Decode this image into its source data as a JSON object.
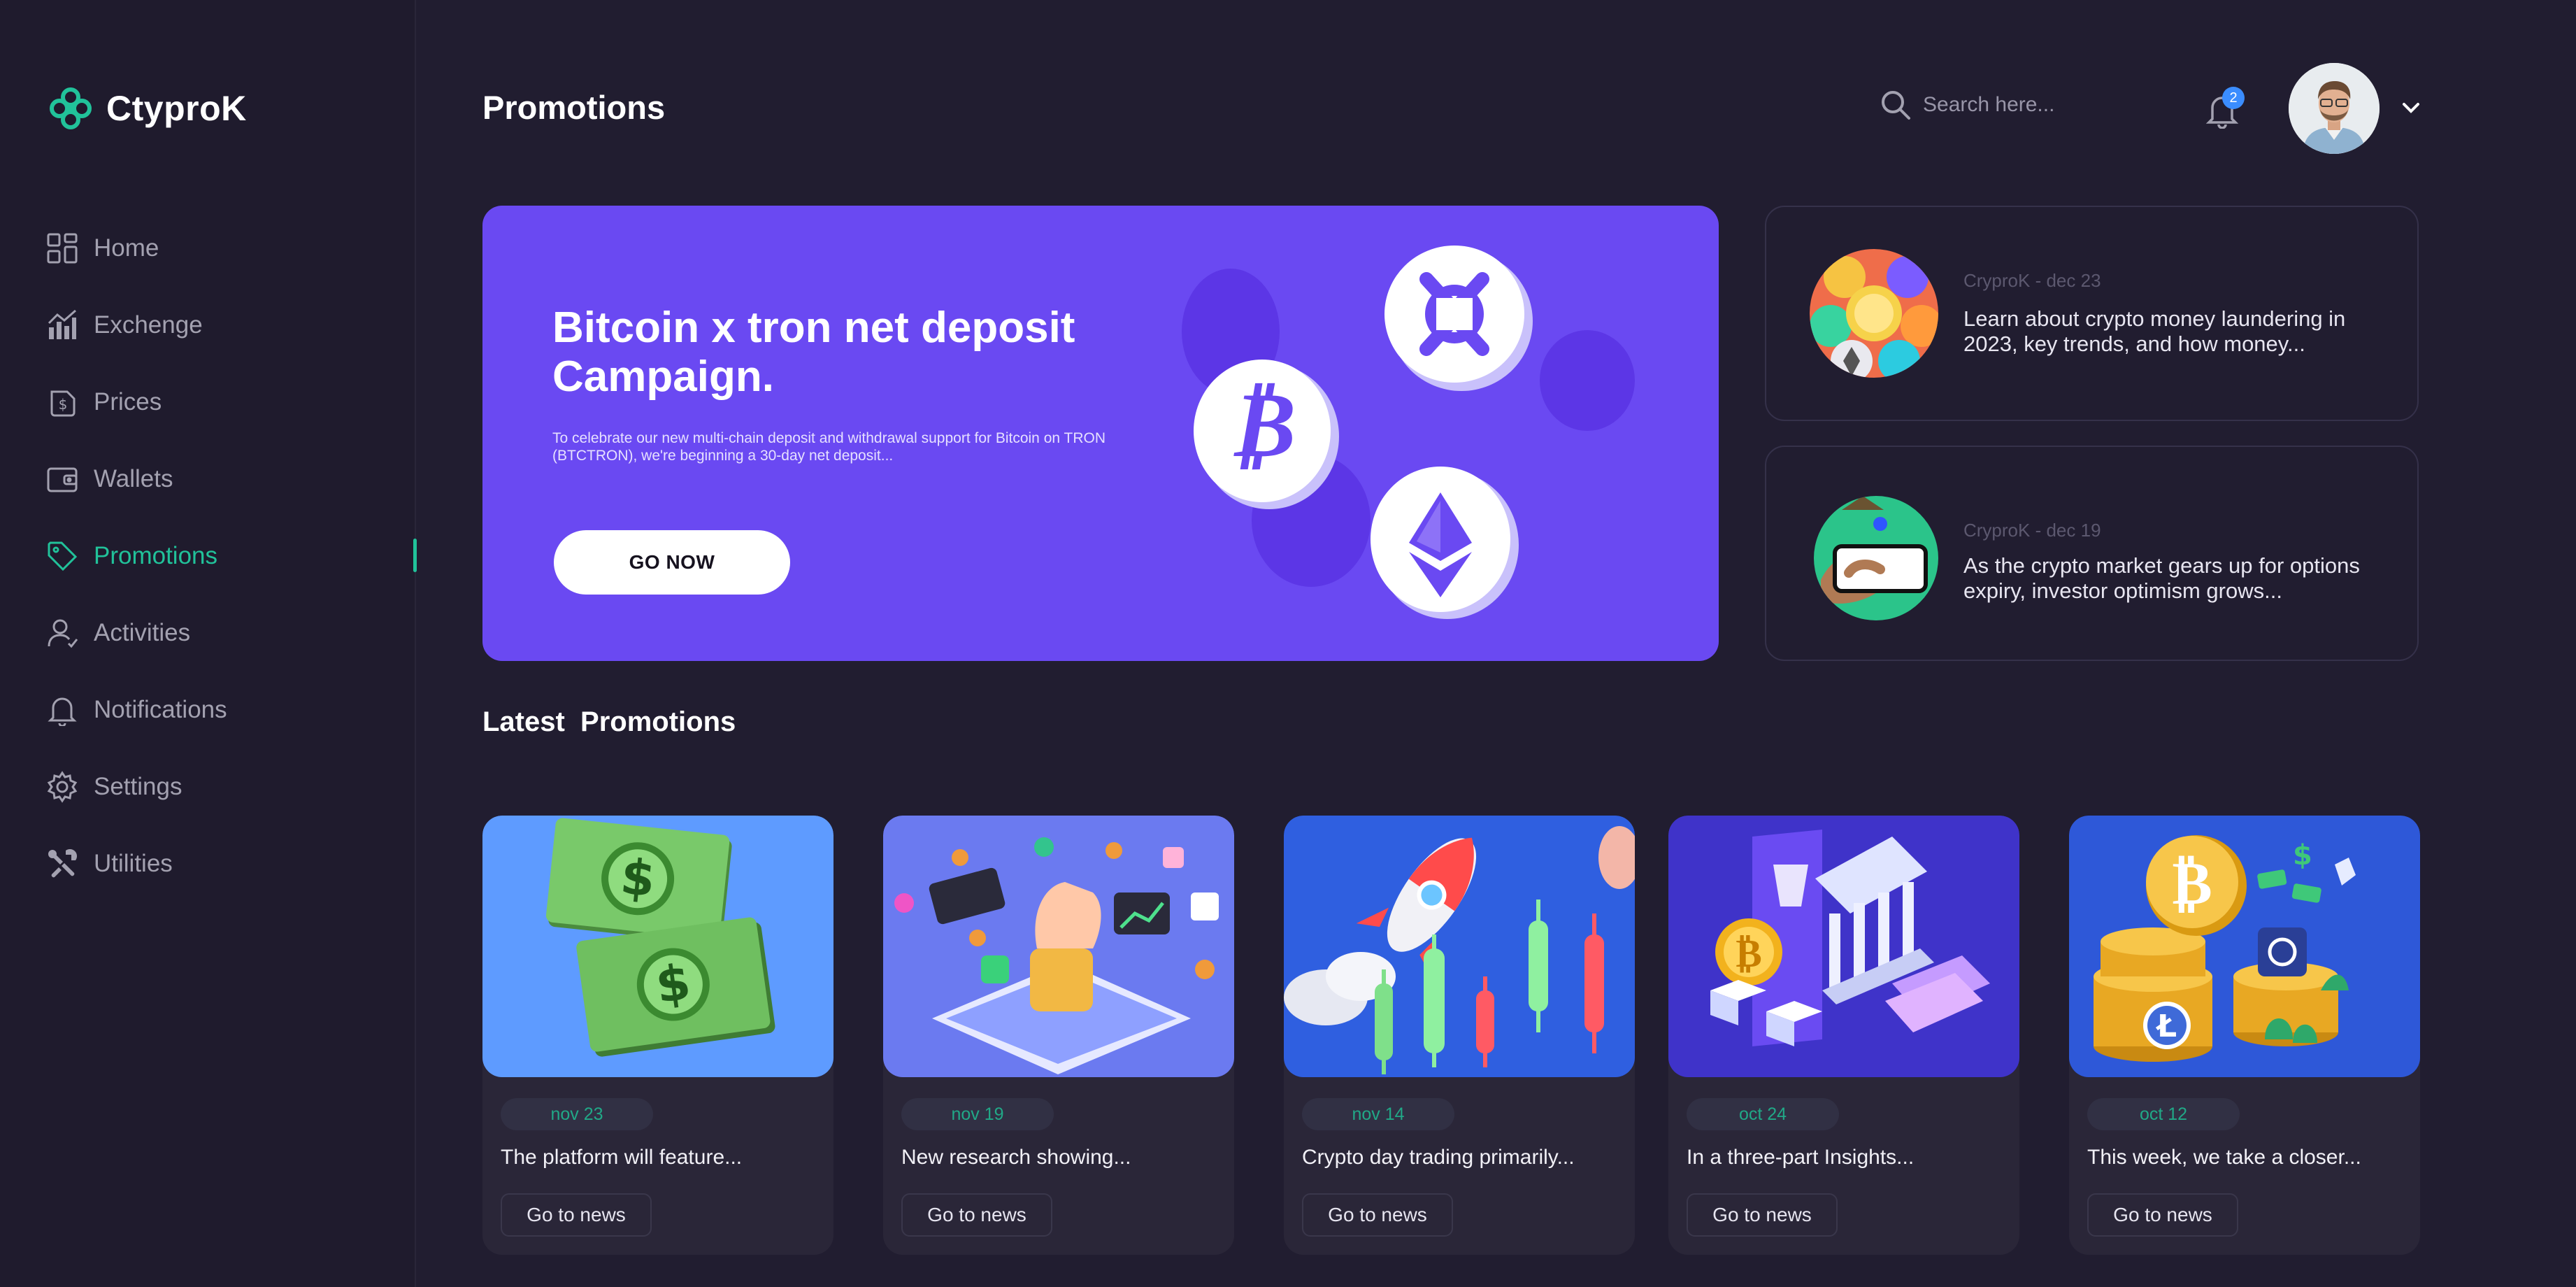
{
  "app": {
    "name": "CtyproK"
  },
  "sidebar": {
    "items": [
      {
        "label": "Home",
        "icon": "grid-icon"
      },
      {
        "label": "Exchenge",
        "icon": "chart-icon"
      },
      {
        "label": "Prices",
        "icon": "price-tag-icon"
      },
      {
        "label": "Wallets",
        "icon": "wallet-icon"
      },
      {
        "label": "Promotions",
        "icon": "tag-icon",
        "active": true
      },
      {
        "label": "Activities",
        "icon": "user-icon"
      },
      {
        "label": "Notifications",
        "icon": "bell-icon"
      },
      {
        "label": "Settings",
        "icon": "gear-icon"
      },
      {
        "label": "Utilities",
        "icon": "tools-icon"
      }
    ]
  },
  "header": {
    "title": "Promotions",
    "search_placeholder": "Search here...",
    "notification_count": "2"
  },
  "hero": {
    "title": "Bitcoin x tron net deposit Campaign.",
    "description": "To celebrate our new multi-chain deposit and withdrawal support for Bitcoin on TRON (BTCTRON), we're beginning a 30-day net deposit...",
    "button": "GO NOW"
  },
  "news": [
    {
      "meta": "CryproK - dec 23",
      "text": "Learn about crypto money laundering in 2023, key trends, and how money..."
    },
    {
      "meta": "CryproK - dec 19",
      "text": "As the crypto market gears up for options expiry, investor optimism grows..."
    }
  ],
  "latest": {
    "title": "Latest  Promotions",
    "cards": [
      {
        "date": "nov 23",
        "text": "The platform will feature...",
        "button": "Go to news"
      },
      {
        "date": "nov 19",
        "text": "New research showing...",
        "button": "Go to news"
      },
      {
        "date": "nov 14",
        "text": "Crypto day trading primarily...",
        "button": "Go to news"
      },
      {
        "date": "oct 24",
        "text": "In a three-part Insights...",
        "button": "Go to news"
      },
      {
        "date": "oct 12",
        "text": "This week, we take a closer...",
        "button": "Go to news"
      }
    ]
  },
  "colors": {
    "accent": "#21c29a",
    "hero": "#6a49f2",
    "background": "#211d30",
    "badge": "#3b8dff"
  }
}
